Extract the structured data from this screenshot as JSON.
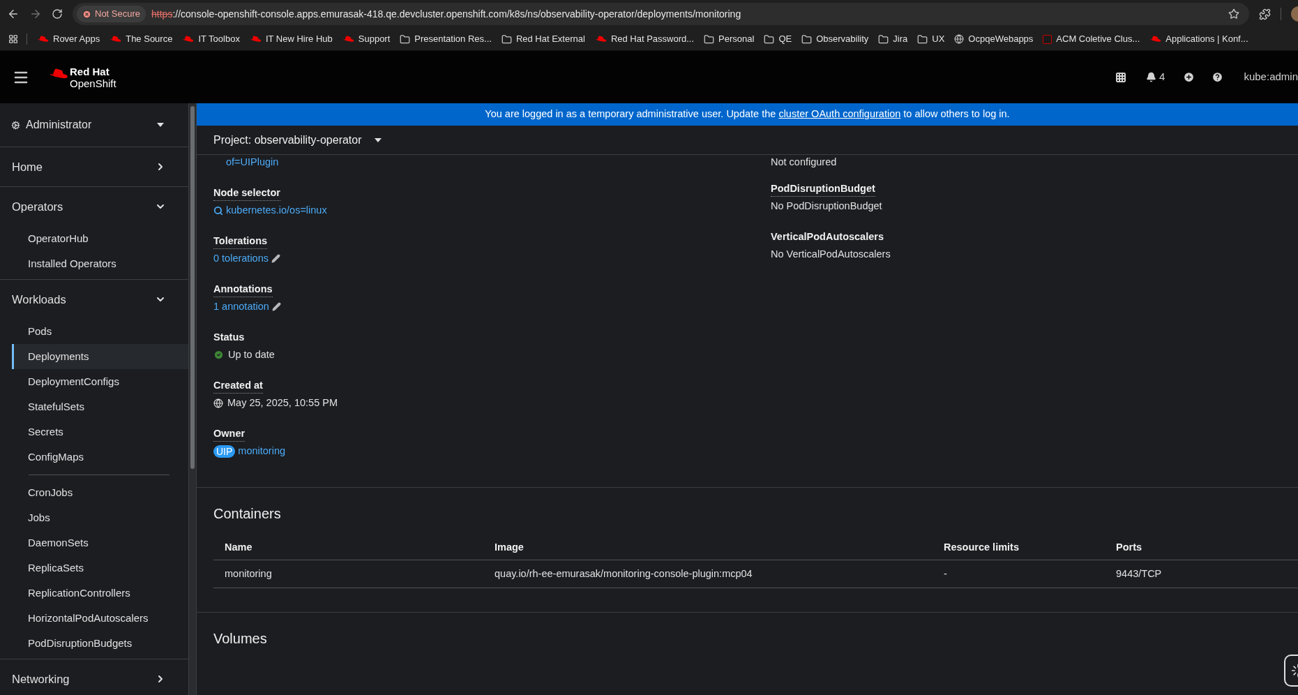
{
  "browser": {
    "security": "Not Secure",
    "url_scheme": "https",
    "url_rest": "://console-openshift-console.apps.emurasak-418.qe.devcluster.openshift.com/k8s/ns/observability-operator/deployments/monitoring"
  },
  "bookmarks": [
    {
      "kind": "redhat",
      "label": "Rover Apps"
    },
    {
      "kind": "redhat",
      "label": "The Source"
    },
    {
      "kind": "redhat",
      "label": "IT Toolbox"
    },
    {
      "kind": "redhat",
      "label": "IT New Hire Hub"
    },
    {
      "kind": "redhat",
      "label": "Support"
    },
    {
      "kind": "folder",
      "label": "Presentation Res..."
    },
    {
      "kind": "folder",
      "label": "Red Hat External"
    },
    {
      "kind": "redhat",
      "label": "Red Hat Password..."
    },
    {
      "kind": "folder",
      "label": "Personal"
    },
    {
      "kind": "folder",
      "label": "QE"
    },
    {
      "kind": "folder",
      "label": "Observability"
    },
    {
      "kind": "folder",
      "label": "Jira"
    },
    {
      "kind": "folder",
      "label": "UX"
    },
    {
      "kind": "globe",
      "label": "OcpqeWebapps"
    },
    {
      "kind": "acm",
      "label": "ACM Coletive Clus..."
    },
    {
      "kind": "redhat",
      "label": "Applications | Konf..."
    }
  ],
  "header": {
    "brand_top": "Red Hat",
    "brand_bottom": "OpenShift",
    "notifications": "4",
    "user": "kube:admin"
  },
  "banner": {
    "text_before": "You are logged in as a temporary administrative user. Update the ",
    "link": "cluster OAuth configuration",
    "text_after": " to allow others to log in."
  },
  "sidebar": {
    "perspective": "Administrator",
    "sections": [
      {
        "label": "Home",
        "expanded": false
      },
      {
        "label": "Operators",
        "expanded": true,
        "groups": [
          [
            {
              "label": "OperatorHub",
              "selected": false
            },
            {
              "label": "Installed Operators",
              "selected": false
            }
          ]
        ]
      },
      {
        "label": "Workloads",
        "expanded": true,
        "groups": [
          [
            {
              "label": "Pods",
              "selected": false
            },
            {
              "label": "Deployments",
              "selected": true
            },
            {
              "label": "DeploymentConfigs",
              "selected": false
            },
            {
              "label": "StatefulSets",
              "selected": false
            },
            {
              "label": "Secrets",
              "selected": false
            },
            {
              "label": "ConfigMaps",
              "selected": false
            }
          ],
          [
            {
              "label": "CronJobs",
              "selected": false
            },
            {
              "label": "Jobs",
              "selected": false
            },
            {
              "label": "DaemonSets",
              "selected": false
            },
            {
              "label": "ReplicaSets",
              "selected": false
            },
            {
              "label": "ReplicationControllers",
              "selected": false
            },
            {
              "label": "HorizontalPodAutoscalers",
              "selected": false
            },
            {
              "label": "PodDisruptionBudgets",
              "selected": false
            }
          ]
        ]
      },
      {
        "label": "Networking",
        "expanded": false
      }
    ]
  },
  "project": "Project: observability-operator",
  "details_left": {
    "top_value": "of=UIPlugin",
    "fields": [
      {
        "kind": "search_link",
        "label": "Node selector",
        "dotted": true,
        "value": "kubernetes.io/os=linux"
      },
      {
        "kind": "edit_link",
        "label": "Tolerations",
        "dotted": true,
        "value": "0 tolerations"
      },
      {
        "kind": "edit_link",
        "label": "Annotations",
        "dotted": true,
        "value": "1 annotation"
      },
      {
        "kind": "status",
        "label": "Status",
        "dotted": false,
        "value": "Up to date"
      },
      {
        "kind": "timestamp",
        "label": "Created at",
        "dotted": true,
        "value": "May 25, 2025, 10:55 PM"
      },
      {
        "kind": "owner",
        "label": "Owner",
        "dotted": true,
        "badge": "UIP",
        "value": "monitoring"
      }
    ]
  },
  "details_right": {
    "top_value": "Not configured",
    "fields": [
      {
        "kind": "text",
        "label": "PodDisruptionBudget",
        "dotted": true,
        "value": "No PodDisruptionBudget"
      },
      {
        "kind": "text",
        "label": "VerticalPodAutoscalers",
        "dotted": false,
        "value": "No VerticalPodAutoscalers"
      }
    ]
  },
  "containers": {
    "title": "Containers",
    "columns": [
      "Name",
      "Image",
      "Resource limits",
      "Ports"
    ],
    "rows": [
      [
        "monitoring",
        "quay.io/rh-ee-emurasak/monitoring-console-plugin:mcp04",
        "-",
        "9443/TCP"
      ]
    ]
  },
  "volumes": {
    "title": "Volumes"
  }
}
